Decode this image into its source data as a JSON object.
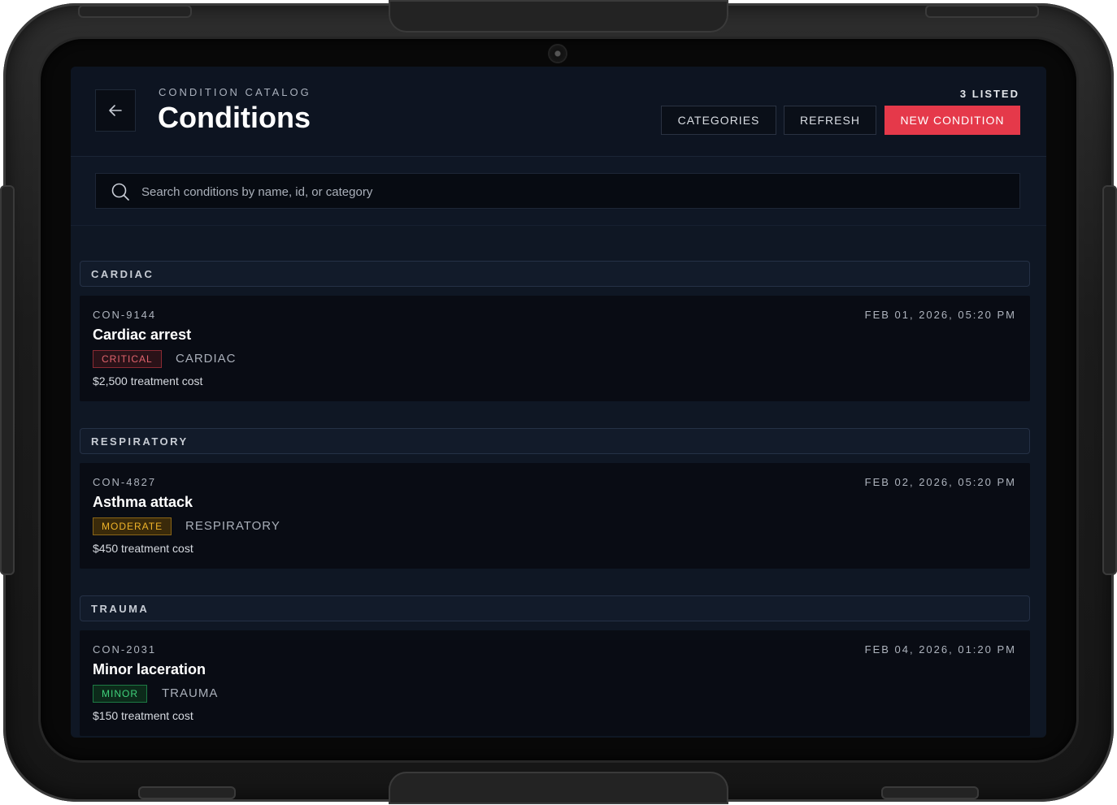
{
  "header": {
    "eyebrow": "CONDITION CATALOG",
    "title": "Conditions",
    "count": "3 LISTED",
    "buttons": {
      "categories": "CATEGORIES",
      "refresh": "REFRESH",
      "new_condition": "NEW CONDITION"
    },
    "back_icon": "arrow-left-icon"
  },
  "search": {
    "placeholder": "Search conditions by name, id, or category",
    "value": "",
    "icon": "search-icon"
  },
  "groups": [
    {
      "label": "CARDIAC",
      "items": [
        {
          "id": "CON-9144",
          "name": "Cardiac arrest",
          "severity": "CRITICAL",
          "category": "CARDIAC",
          "cost": "$2,500 treatment cost",
          "date": "FEB 01, 2026, 05:20 PM"
        }
      ]
    },
    {
      "label": "RESPIRATORY",
      "items": [
        {
          "id": "CON-4827",
          "name": "Asthma attack",
          "severity": "MODERATE",
          "category": "RESPIRATORY",
          "cost": "$450 treatment cost",
          "date": "FEB 02, 2026, 05:20 PM"
        }
      ]
    },
    {
      "label": "TRAUMA",
      "items": [
        {
          "id": "CON-2031",
          "name": "Minor laceration",
          "severity": "MINOR",
          "category": "TRAUMA",
          "cost": "$150 treatment cost",
          "date": "FEB 04, 2026, 01:20 PM"
        }
      ]
    }
  ],
  "colors": {
    "accent": "#e5394a",
    "critical": "#e0636d",
    "moderate": "#f0b429",
    "minor": "#3fd07a",
    "screen_bg": "#0f1724"
  }
}
